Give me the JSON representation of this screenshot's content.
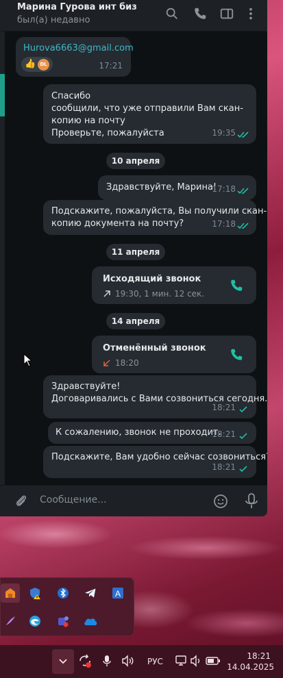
{
  "header": {
    "title": "Марина Гурова инт биз",
    "status": "был(а) недавно"
  },
  "messages": {
    "email": {
      "text": "Hurova6663@gmail.com",
      "time": "17:21",
      "reactions": [
        "👍",
        "DL"
      ]
    },
    "thanks": {
      "lines": [
        "Спасибо",
        "сообщили, что уже отправили Вам скан-",
        "копию на почту",
        "Проверьте, пожалуйста"
      ],
      "time": "19:35"
    },
    "date1": "10 апреля",
    "hello": {
      "text": "Здравствуйте, Марина!",
      "time": "17:18"
    },
    "question": {
      "lines": [
        "Подскажите, пожалуйста, Вы получили скан-",
        "копию документа на почту?"
      ],
      "time": "17:18"
    },
    "date2": "11 апреля",
    "outgoing_call": {
      "title": "Исходящий звонок",
      "details": "19:30, 1 мин. 12 сек."
    },
    "date3": "14 апреля",
    "cancelled_call": {
      "title": "Отменённый звонок",
      "details": "18:20"
    },
    "agreed": {
      "lines": [
        "Здравствуйте!",
        "Договаривались с Вами созвониться сегодня."
      ],
      "time": "18:21"
    },
    "failed": {
      "text": "К сожалению, звонок не проходит.",
      "time": "18:21"
    },
    "convenient": {
      "text": "Подскажите, Вам удобно сейчас созвониться?",
      "time": "18:21"
    }
  },
  "composer": {
    "placeholder": "Сообщение..."
  },
  "tray_icons": [
    "app-orange-icon",
    "shield-warning-icon",
    "bluetooth-icon",
    "telegram-icon",
    "translator-icon",
    "pen-icon",
    "edge-icon",
    "teams-icon",
    "onedrive-icon"
  ],
  "taskbar": {
    "language": "РУС",
    "time": "18:21",
    "date": "14.04.2025"
  },
  "colors": {
    "accent": "#1fbfa5",
    "bubble": "#252b30",
    "link": "#3fb8c9",
    "missed": "#e0663a"
  }
}
